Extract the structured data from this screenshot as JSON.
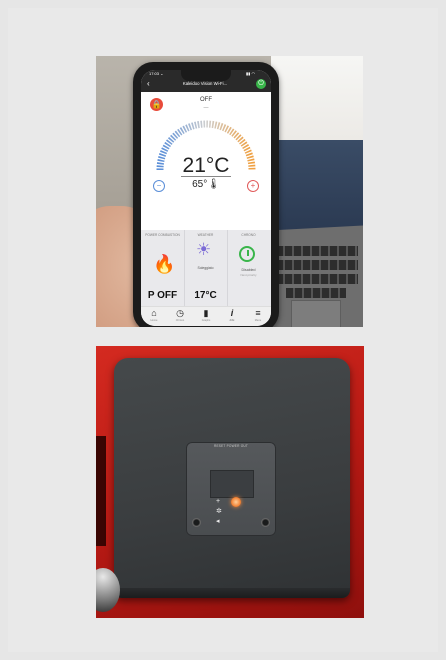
{
  "photo_top": {
    "phone_screen": {
      "status_time": "17:03 ⌄",
      "status_signal": "▮▮ ◠",
      "app_title": "Kaleidoo Vision Wi-Fi...",
      "mode": "OFF",
      "mode_sub": "—",
      "room_temp": "21°C",
      "set_temp": "65°🌡",
      "minus": "−",
      "plus": "+",
      "cards": [
        {
          "head": "POWER COMBUSTION",
          "value": "P OFF"
        },
        {
          "head": "WEATHER",
          "label": "Soleggiato",
          "value": "17°C"
        },
        {
          "head": "CHRONO",
          "label": "Disabled",
          "sub": "Next priority"
        }
      ],
      "tabs": [
        {
          "icon": "⌂",
          "label": "Home"
        },
        {
          "icon": "◷",
          "label": "Chrono"
        },
        {
          "icon": "▮",
          "label": "Graphs"
        },
        {
          "icon": "i",
          "label": "Info"
        },
        {
          "icon": "≡",
          "label": "Menu"
        }
      ],
      "colors": {
        "lock": "#e84b3a",
        "power": "#39b54a",
        "flame": "#e84b3a",
        "sun": "#7b6ad6",
        "chrono": "#39b54a"
      }
    }
  },
  "photo_bottom": {
    "controller_top_labels": "RESET  POWER  OUT",
    "icons": [
      "plus-icon",
      "snowflake-icon",
      "fan-icon"
    ]
  }
}
